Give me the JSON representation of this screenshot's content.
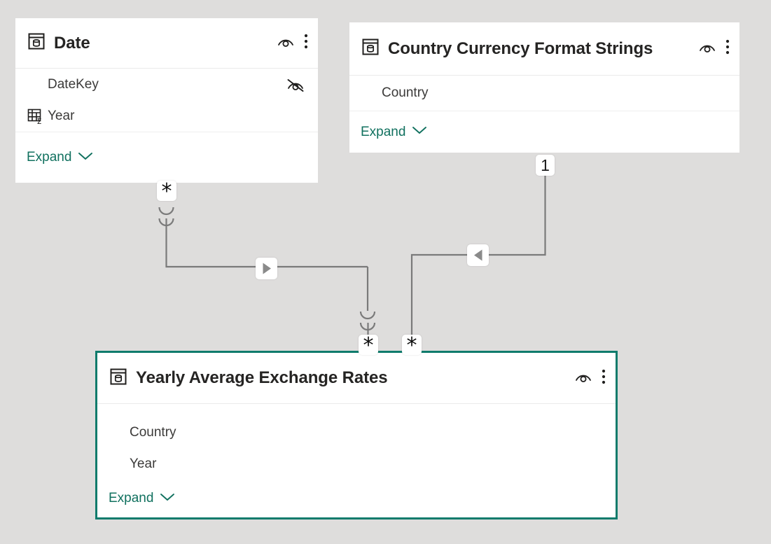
{
  "canvas": {
    "background_color": "#dedddc",
    "selected_border_color": "#0f7b6c",
    "link_color": "#11715f",
    "connector_color": "#7a7a7a"
  },
  "tables": [
    {
      "id": "date",
      "name": "Date",
      "table_icon": "table-database-icon",
      "view_icon": "eye-visible-icon",
      "menu_icon": "more-options-icon",
      "selected": false,
      "fields": [
        {
          "name": "DateKey",
          "leading_icon": null,
          "trailing_icon": "eye-hidden-icon"
        },
        {
          "name": "Year",
          "leading_icon": "summarize-table-sigma-icon",
          "trailing_icon": null
        }
      ],
      "expand": {
        "label": "Expand",
        "icon": "chevron-down-icon"
      }
    },
    {
      "id": "country-currency-format-strings",
      "name": "Country Currency Format Strings",
      "table_icon": "table-database-icon",
      "view_icon": "eye-visible-icon",
      "menu_icon": "more-options-icon",
      "selected": false,
      "fields": [
        {
          "name": "Country",
          "leading_icon": null,
          "trailing_icon": null
        }
      ],
      "expand": {
        "label": "Expand",
        "icon": "chevron-down-icon"
      }
    },
    {
      "id": "yearly-average-exchange-rates",
      "name": "Yearly Average Exchange Rates",
      "table_icon": "table-database-icon",
      "view_icon": "eye-visible-icon",
      "menu_icon": "more-options-icon",
      "selected": true,
      "fields": [
        {
          "name": "Country",
          "leading_icon": null,
          "trailing_icon": null
        },
        {
          "name": "Year",
          "leading_icon": null,
          "trailing_icon": null
        }
      ],
      "expand": {
        "label": "Expand",
        "icon": "chevron-down-icon"
      }
    }
  ],
  "relationships": [
    {
      "id": "date-to-exchange-rates",
      "from_table": "Date",
      "to_table": "Yearly Average Exchange Rates",
      "from_cardinality": "*",
      "to_cardinality": "*",
      "cross_filter_direction": "right",
      "filter_arrow_icon": "play-right-icon"
    },
    {
      "id": "country-currency-to-exchange-rates",
      "from_table": "Country Currency Format Strings",
      "to_table": "Yearly Average Exchange Rates",
      "from_cardinality": "1",
      "to_cardinality": "*",
      "cross_filter_direction": "left",
      "filter_arrow_icon": "play-left-icon"
    }
  ],
  "markers": {
    "date_many": "*",
    "currency_one": "1",
    "exchange_many_left": "*",
    "exchange_many_right": "*"
  }
}
